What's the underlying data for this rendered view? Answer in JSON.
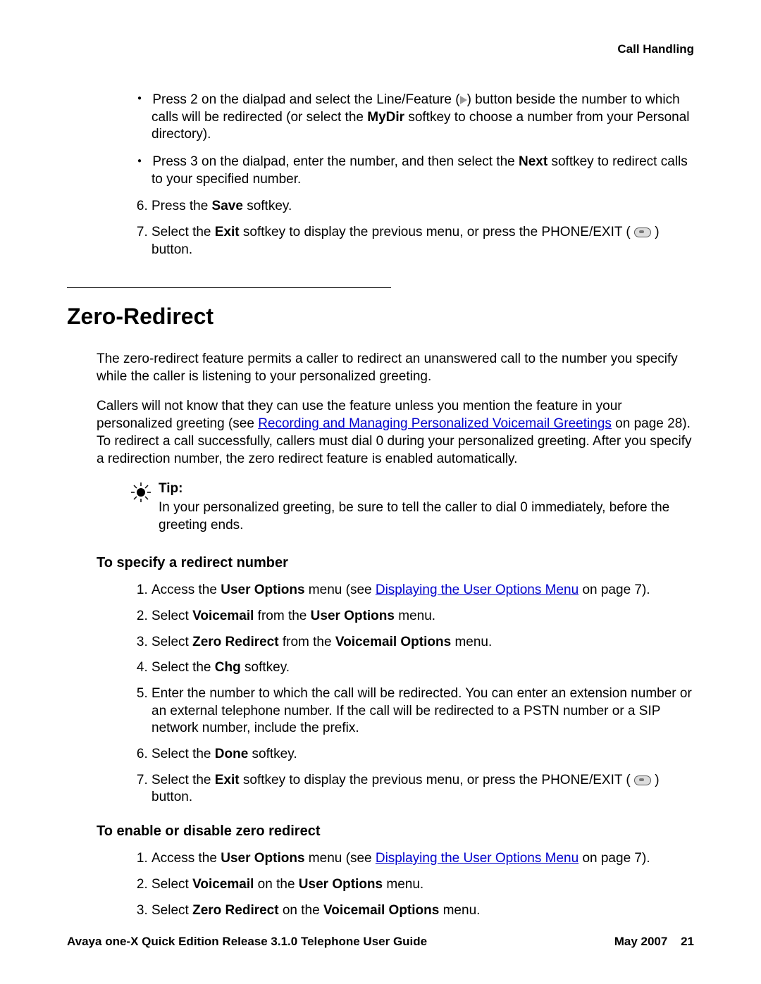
{
  "header": {
    "section_title": "Call Handling"
  },
  "top": {
    "bullets": [
      {
        "pre": "Press 2 on the dialpad and select the Line/Feature (",
        "post": ") button beside the number to which calls will be redirected (or select the ",
        "bold1": "MyDir",
        "tail": " softkey to choose a number from your Personal directory)."
      },
      {
        "pre": "Press 3 on the dialpad, enter the number, and then select the ",
        "bold1": "Next",
        "tail": " softkey to redirect calls to your specified number."
      }
    ],
    "step6": {
      "pre": "Press the ",
      "bold1": "Save",
      "post": " softkey."
    },
    "step7": {
      "pre": "Select the ",
      "bold1": "Exit",
      "mid": " softkey to display the previous menu, or press the PHONE/EXIT ( ",
      "post": " ) button."
    }
  },
  "section": {
    "title": "Zero-Redirect",
    "para1": "The zero-redirect feature permits a caller to redirect an unanswered call to the number you specify while the caller is listening to your personalized greeting.",
    "para2_pre": "Callers will not know that they can use the feature unless you mention the feature in your personalized greeting (see ",
    "para2_link": "Recording and Managing Personalized Voicemail Greetings",
    "para2_post": " on page 28). To redirect a call successfully, callers must dial 0 during your personalized greeting. After you specify a redirection number, the zero redirect feature is enabled automatically.",
    "tip_label": "Tip:",
    "tip_text": "In your personalized greeting, be sure to tell the caller to dial 0 immediately, before the greeting ends."
  },
  "sub1": {
    "heading": "To specify a redirect number",
    "steps": {
      "s1": {
        "pre": "Access the ",
        "bold1": "User Options",
        "mid": " menu (see ",
        "link": "Displaying the User Options Menu",
        "post": " on page 7)."
      },
      "s2": {
        "pre": "Select ",
        "bold1": "Voicemail",
        "mid": " from the ",
        "bold2": "User Options",
        "post": " menu."
      },
      "s3": {
        "pre": "Select ",
        "bold1": "Zero Redirect",
        "mid": " from the ",
        "bold2": "Voicemail Options",
        "post": " menu."
      },
      "s4": {
        "pre": "Select the ",
        "bold1": "Chg",
        "post": " softkey."
      },
      "s5": "Enter the number to which the call will be redirected. You can enter an extension number or an external telephone number. If the call will be redirected to a PSTN number or a SIP network number, include the prefix.",
      "s6": {
        "pre": "Select the ",
        "bold1": "Done",
        "post": " softkey."
      },
      "s7": {
        "pre": "Select the ",
        "bold1": "Exit",
        "mid": " softkey to display the previous menu, or press the PHONE/EXIT ( ",
        "post": " ) button."
      }
    }
  },
  "sub2": {
    "heading": "To enable or disable zero redirect",
    "steps": {
      "s1": {
        "pre": "Access the ",
        "bold1": "User Options",
        "mid": " menu (see ",
        "link": "Displaying the User Options Menu",
        "post": " on page 7)."
      },
      "s2": {
        "pre": "Select ",
        "bold1": "Voicemail",
        "mid": " on the ",
        "bold2": "User Options",
        "post": " menu."
      },
      "s3": {
        "pre": "Select ",
        "bold1": "Zero Redirect",
        "mid": " on the ",
        "bold2": "Voicemail Options",
        "post": " menu."
      }
    }
  },
  "footer": {
    "left": "Avaya one-X Quick Edition Release 3.1.0 Telephone User Guide",
    "date": "May 2007",
    "page": "21"
  }
}
